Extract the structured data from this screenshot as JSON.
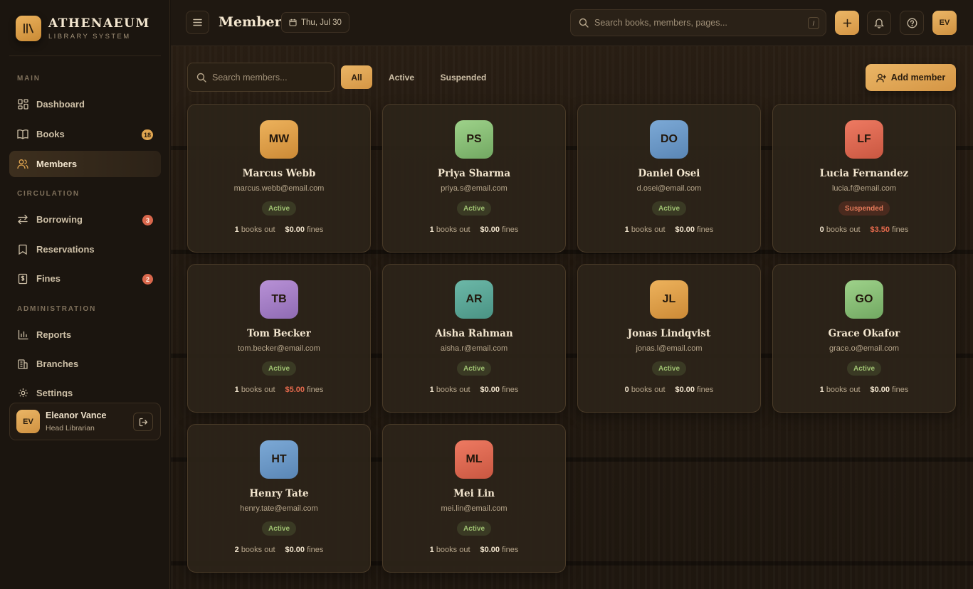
{
  "brand": {
    "name": "ATHENAEUM",
    "subtitle": "LIBRARY SYSTEM"
  },
  "sidebar": {
    "sections": {
      "main": "MAIN",
      "circulation": "CIRCULATION",
      "administration": "ADMINISTRATION"
    },
    "items": [
      {
        "label": "Dashboard",
        "icon": "grid-icon"
      },
      {
        "label": "Books",
        "icon": "book-icon",
        "badge": "18"
      },
      {
        "label": "Members",
        "icon": "users-icon",
        "active": true
      },
      {
        "label": "Borrowing",
        "icon": "arrows-icon",
        "badge": "3"
      },
      {
        "label": "Reservations",
        "icon": "bookmark-icon"
      },
      {
        "label": "Fines",
        "icon": "receipt-icon",
        "badge": "2"
      },
      {
        "label": "Reports",
        "icon": "bar-chart-icon"
      },
      {
        "label": "Branches",
        "icon": "building-icon"
      },
      {
        "label": "Settings",
        "icon": "gear-icon"
      }
    ],
    "user": {
      "initials": "EV",
      "name": "Eleanor Vance",
      "role": "Head Librarian"
    }
  },
  "header": {
    "title": "Members",
    "date": "Thu, Jul 30",
    "search_placeholder": "Search books, members, pages...",
    "search_shortcut": "/",
    "avatar_initials": "EV"
  },
  "toolbar": {
    "search_placeholder": "Search members...",
    "filters": [
      "All",
      "Active",
      "Suspended"
    ],
    "active_filter": "All",
    "add_label": "Add member"
  },
  "stats_labels": {
    "books": "books out",
    "fines": "fines"
  },
  "members": [
    {
      "initials": "MW",
      "name": "Marcus Webb",
      "email": "marcus.webb@email.com",
      "status": "Active",
      "books": "1",
      "fines": "$0.00",
      "color": "#e0a04a"
    },
    {
      "initials": "PS",
      "name": "Priya Sharma",
      "email": "priya.s@email.com",
      "status": "Active",
      "books": "1",
      "fines": "$0.00",
      "color": "#8ec27a"
    },
    {
      "initials": "DO",
      "name": "Daniel Osei",
      "email": "d.osei@email.com",
      "status": "Active",
      "books": "1",
      "fines": "$0.00",
      "color": "#6b98c8"
    },
    {
      "initials": "LF",
      "name": "Lucia Fernandez",
      "email": "lucia.f@email.com",
      "status": "Suspended",
      "books": "0",
      "fines": "$3.50",
      "color": "#e06a52"
    },
    {
      "initials": "TB",
      "name": "Tom Becker",
      "email": "tom.becker@email.com",
      "status": "Active",
      "books": "1",
      "fines": "$5.00",
      "color": "#a883c8"
    },
    {
      "initials": "AR",
      "name": "Aisha Rahman",
      "email": "aisha.r@email.com",
      "status": "Active",
      "books": "1",
      "fines": "$0.00",
      "color": "#5ba898"
    },
    {
      "initials": "JL",
      "name": "Jonas Lindqvist",
      "email": "jonas.l@email.com",
      "status": "Active",
      "books": "0",
      "fines": "$0.00",
      "color": "#e0a04a"
    },
    {
      "initials": "GO",
      "name": "Grace Okafor",
      "email": "grace.o@email.com",
      "status": "Active",
      "books": "1",
      "fines": "$0.00",
      "color": "#8ec27a"
    },
    {
      "initials": "HT",
      "name": "Henry Tate",
      "email": "henry.tate@email.com",
      "status": "Active",
      "books": "2",
      "fines": "$0.00",
      "color": "#6b98c8"
    },
    {
      "initials": "ML",
      "name": "Mei Lin",
      "email": "mei.lin@email.com",
      "status": "Active",
      "books": "1",
      "fines": "$0.00",
      "color": "#e06a52"
    }
  ],
  "colors": {
    "accent": "#e0a550",
    "danger": "#d9674c",
    "success": "#9fc271"
  }
}
